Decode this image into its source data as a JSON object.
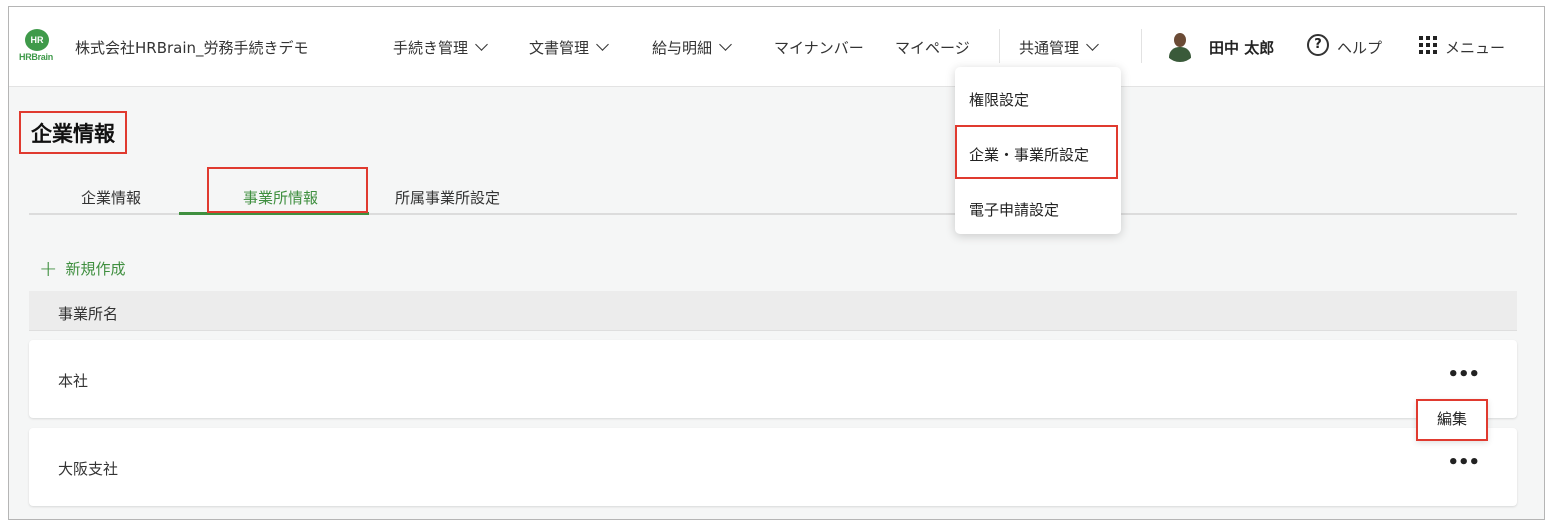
{
  "header": {
    "logo_top": "HR",
    "logo_bottom": "HRBrain",
    "company": "株式会社HRBrain_労務手続きデモ",
    "nav": [
      {
        "label": "手続き管理",
        "has_dropdown": true
      },
      {
        "label": "文書管理",
        "has_dropdown": true
      },
      {
        "label": "給与明細",
        "has_dropdown": true
      },
      {
        "label": "マイナンバー",
        "has_dropdown": false
      },
      {
        "label": "マイページ",
        "has_dropdown": false
      },
      {
        "label": "共通管理",
        "has_dropdown": true
      }
    ],
    "user_name": "田中 太郎",
    "help_label": "ヘルプ",
    "help_glyph": "?",
    "menu_label": "メニュー"
  },
  "dropdown": {
    "items": [
      "権限設定",
      "企業・事業所設定",
      "電子申請設定"
    ],
    "highlighted_index": 1
  },
  "page": {
    "title": "企業情報",
    "tabs": [
      "企業情報",
      "事業所情報",
      "所属事業所設定"
    ],
    "active_tab": 1,
    "new_button": "新規作成",
    "new_button_glyph": "+",
    "list_header": "事業所名",
    "rows": [
      "本社",
      "大阪支社"
    ],
    "more_glyph": "•••",
    "edit_label": "編集"
  },
  "colors": {
    "accent_green": "#3f8f3f",
    "highlight_red": "#e03a2f"
  }
}
